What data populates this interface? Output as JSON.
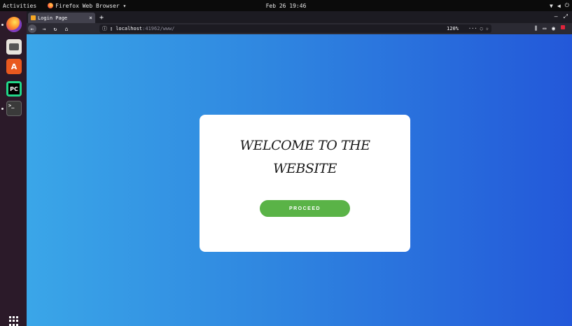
{
  "topbar": {
    "activities": "Activities",
    "app_name": "Firefox Web Browser ▾",
    "clock": "Feb 26 19:46"
  },
  "browser": {
    "tab": {
      "title": "Login Page",
      "close": "×"
    },
    "new_tab": "+",
    "url": {
      "host": "localhost",
      "rest": ":41962/www/"
    },
    "zoom": "120%"
  },
  "page": {
    "heading_line1": "WELCOME TO THE",
    "heading_line2": "WEBSITE",
    "proceed_label": "PROCEED"
  },
  "colors": {
    "gradient_start": "#3aa6e8",
    "gradient_end": "#2358d9",
    "button": "#5ab347",
    "card": "#ffffff"
  },
  "icons": [
    "firefox-icon",
    "files-icon",
    "software-icon",
    "pycharm-icon",
    "terminal-icon",
    "show-apps-icon",
    "back-icon",
    "forward-icon",
    "reload-icon",
    "home-icon",
    "info-icon",
    "page-icon",
    "more-icon",
    "pocket-icon",
    "bookmark-star-icon",
    "library-icon",
    "sidebar-icon",
    "account-icon",
    "extension-icon"
  ]
}
